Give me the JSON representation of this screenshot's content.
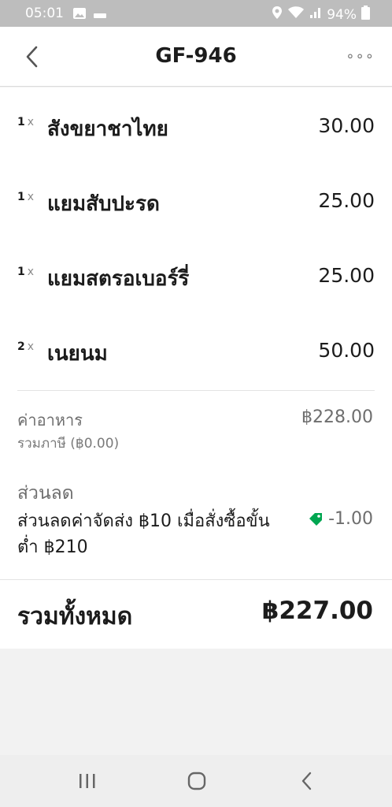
{
  "status_bar": {
    "time": "05:01",
    "battery": "94%"
  },
  "header": {
    "title": "GF-946",
    "more_label": "∘∘∘"
  },
  "items": [
    {
      "qty": "1",
      "x": "x",
      "name": "สังขยาชาไทย",
      "price": "30.00"
    },
    {
      "qty": "1",
      "x": "x",
      "name": "แยมสับปะรด",
      "price": "25.00"
    },
    {
      "qty": "1",
      "x": "x",
      "name": "แยมสตรอเบอร์รี่",
      "price": "25.00"
    },
    {
      "qty": "2",
      "x": "x",
      "name": "เนยนม",
      "price": "50.00"
    }
  ],
  "summary": {
    "food_label": "ค่าอาหาร",
    "food_value": "฿228.00",
    "tax_label": "รวมภาษี (฿0.00)",
    "discount_title": "ส่วนลด",
    "discount_desc": "ส่วนลดค่าจัดส่ง ฿10 เมื่อสั่งซื้อขั้นต่ำ ฿210",
    "discount_value": "-1.00",
    "total_label": "รวมทั้งหมด",
    "total_value": "฿227.00"
  },
  "colors": {
    "accent_green": "#00a651",
    "status_bar": "#bdbdbd"
  },
  "icons": {
    "back": "chevron-left-icon",
    "discount": "tag-icon",
    "more": "more-dots-icon"
  }
}
